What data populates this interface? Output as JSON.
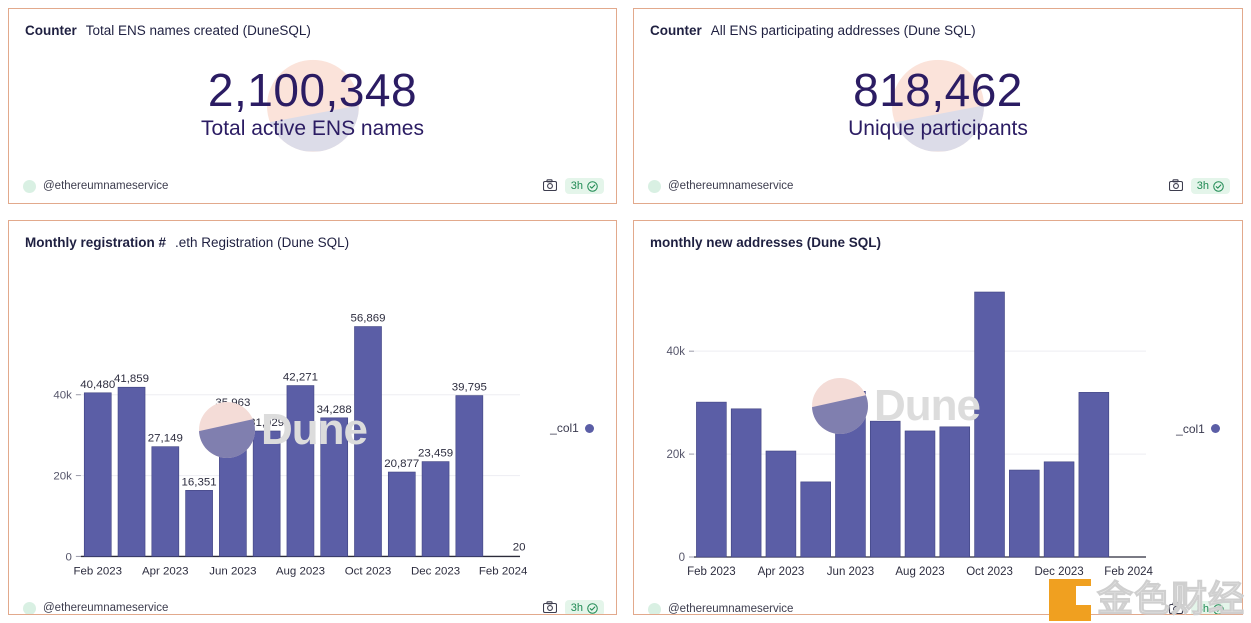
{
  "cards": {
    "counter_left": {
      "kind": "Counter",
      "title": "Total ENS names created (DuneSQL)",
      "value": "2,100,348",
      "label": "Total active ENS names",
      "handle": "@ethereumnameservice",
      "freshness": "3h",
      "camera_icon": "camera-icon",
      "check_icon": "check-circle-icon"
    },
    "counter_right": {
      "kind": "Counter",
      "title": "All ENS participating addresses (Dune SQL)",
      "value": "818,462",
      "label": "Unique participants",
      "handle": "@ethereumnameservice",
      "freshness": "3h",
      "camera_icon": "camera-icon",
      "check_icon": "check-circle-icon"
    },
    "chart_left": {
      "title_bold": "Monthly registration #",
      "title_rest": ".eth Registration (Dune SQL)",
      "handle": "@ethereumnameservice",
      "freshness": "3h",
      "legend_label": "_col1"
    },
    "chart_right": {
      "title_bold": "monthly new addresses (Dune SQL)",
      "title_rest": "",
      "handle": "@ethereumnameservice",
      "freshness": "3h",
      "legend_label": "_col1"
    }
  },
  "watermark": {
    "dune_text": "Dune",
    "jinse_text": "金色财经"
  },
  "colors": {
    "bar": "#5b5ea6",
    "card_border": "#e2a98c",
    "counter_text": "#2b1c63",
    "badge_bg": "#e4f5ea",
    "badge_text": "#1f8a53",
    "logo_orange": "#f0a020"
  },
  "chart_data": [
    {
      "type": "bar",
      "title": "Monthly registration # .eth Registration (Dune SQL)",
      "xlabel": "",
      "ylabel": "",
      "ylim": [
        0,
        60000
      ],
      "yticks": [
        0,
        20000,
        40000
      ],
      "ytick_labels": [
        "0",
        "20k",
        "40k"
      ],
      "grid": true,
      "legend": [
        "_col1"
      ],
      "legend_position": "right",
      "categories": [
        "Feb 2023",
        "Mar 2023",
        "Apr 2023",
        "May 2023",
        "Jun 2023",
        "Jul 2023",
        "Aug 2023",
        "Sep 2023",
        "Oct 2023",
        "Nov 2023",
        "Dec 2023",
        "Jan 2024",
        "Feb 2024"
      ],
      "tick_categories": [
        "Feb 2023",
        "Apr 2023",
        "Jun 2023",
        "Aug 2023",
        "Oct 2023",
        "Dec 2023",
        "Feb 2024"
      ],
      "values": [
        40480,
        41859,
        27149,
        16351,
        35963,
        31029,
        42271,
        34288,
        56869,
        20877,
        23459,
        39795,
        20
      ],
      "data_labels": [
        "40,480",
        "41,859",
        "27,149",
        "16,351",
        "35,963",
        "31,029",
        "42,271",
        "34,288",
        "56,869",
        "20,877",
        "23,459",
        "39,795",
        "20"
      ]
    },
    {
      "type": "bar",
      "title": "monthly new addresses (Dune SQL)",
      "xlabel": "",
      "ylabel": "",
      "ylim": [
        0,
        55000
      ],
      "yticks": [
        0,
        20000,
        40000
      ],
      "ytick_labels": [
        "0",
        "20k",
        "40k"
      ],
      "grid": true,
      "legend": [
        "_col1"
      ],
      "legend_position": "right",
      "categories": [
        "Feb 2023",
        "Mar 2023",
        "Apr 2023",
        "May 2023",
        "Jun 2023",
        "Jul 2023",
        "Aug 2023",
        "Sep 2023",
        "Oct 2023",
        "Nov 2023",
        "Dec 2023",
        "Jan 2024",
        "Feb 2024"
      ],
      "tick_categories": [
        "Feb 2023",
        "Apr 2023",
        "Jun 2023",
        "Aug 2023",
        "Oct 2023",
        "Dec 2023",
        "Feb 2024"
      ],
      "values": [
        30100,
        28800,
        20600,
        14600,
        32200,
        26400,
        24500,
        25300,
        51500,
        16900,
        18500,
        32000,
        0
      ],
      "data_labels": []
    }
  ]
}
